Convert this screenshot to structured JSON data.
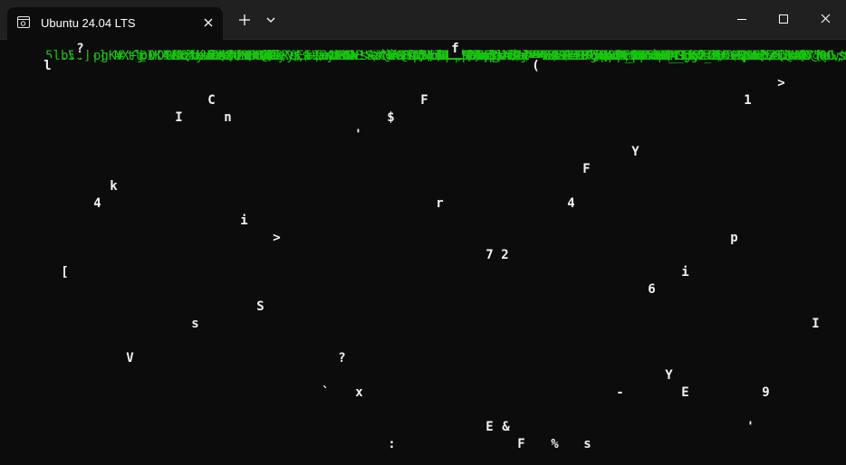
{
  "window": {
    "tab_title": "Ubuntu 24.04 LTS",
    "tab_icon": "terminal-tux-icon",
    "new_tab_icon": "plus-icon",
    "dropdown_icon": "chevron-down-icon",
    "controls": [
      "minimize-icon",
      "maximize-icon",
      "close-icon"
    ]
  },
  "terminal": {
    "text_color": "#16c60c",
    "highlight_color": "#f2f2f2",
    "background": "#0c0c0c",
    "columns": [
      "                  VD%N8c+UTXX",
      "                   %o\"y-h$[fV",
      "5l.50]-]'NX+j      b tm/ !L4CX",
      "bV                 o k /xk%%%",
      "?          !+h[               ",
      "pgK#.^@IK4                    ",
      "    o0'YIk                    ",
      "tl   8h\"XXVee8UmBB#V          ",
      "                     aa+vAb   ",
      "             Ak               ",
      "AzViIXh'zQ*.1?'s             ",
      "dxi\"eh t.@  .                  ",
      "lA\"C n l+y^$  iY       `  w.  .",
      "2d8DnNl+y^$   i             ",
      "                      q[<mM   ",
      "\\]mRcEIVSy00h!>:`wS    JSCf?'q[]",
      "l/Q,cIa1F0N!9  `  JSCf?'q[]   ",
      "   ,cNFSv AsNfN1VbtCf3'?Ru$<m`",
      "+\\:t'N s'X@A*fN  VtbM?u;?U!$<yU",
      "  sD    '                     ",
      "sHE'$Xsx@A  o   9bbqg?U!$<svs",
      "                o  #3ah8o5E$EP",
      "z^k-F7;)3qr   #3ah8oDNBBE>?7   ",
      "PS!67;)3qr                    ",
      "f             ejtY?0Sk2P?T\\    ",
      "NbS5L'dSt?vfZJ7PL<+L'R'oo2s   ",
      "SeQ5aBZ^v\\J7e7 :J  +;Rw51%.   ",
      "              E#CP5V5i7E:&    ",
      "              IV]=LrrVIrK&    ",
      "q(             ,<A_b#xWI4Tf/%",
      "            R,<A_b#xWI4T1/    ",
      "  zCz4TTBlqqd4               ",
      "  )  F:g bq qq                 ",
      "         ..2c`z#CLr2T-   /    ",
      "  \" D=EE0UTU2__ S2v6 \\\\S5?Z%2 ",
      "  5DS,YE:+7_SpSzd\\OO0*R'/     ",
      "       :cN9!RiO0             ",
      "   x H2    s1H HSUdx#D@^C    ",
      "                    cNR \\  : ",
      "6p)ITKf_Ars1pHHSUdx#D@^C    ",
      "      a  'pu[hS Ar6'9C fc  ",
      "ggl:!!:S 'I    A7\"> ,        ",
      "   <         [      #7?&r   ",
      ")T>          [u\\$NVfkgSy     ",
      "+^u>:![1m>'Npwsh$INvfkgsy    "
    ],
    "highlights": [
      {
        "text": "l"
      },
      {
        "text": "?"
      },
      {
        "text": "f"
      },
      {
        "text": "("
      },
      {
        "text": ">"
      },
      {
        "text": "1"
      },
      {
        "text": "C"
      },
      {
        "text": "F"
      },
      {
        "text": "I"
      },
      {
        "text": "n"
      },
      {
        "text": "$"
      },
      {
        "text": "'"
      },
      {
        "text": "k"
      },
      {
        "text": "Y"
      },
      {
        "text": "F"
      },
      {
        "text": "4"
      },
      {
        "text": "r"
      },
      {
        "text": "4"
      },
      {
        "text": "i"
      },
      {
        "text": ">"
      },
      {
        "text": "p"
      },
      {
        "text": "7"
      },
      {
        "text": "2"
      },
      {
        "text": "["
      },
      {
        "text": "i"
      },
      {
        "text": "S"
      },
      {
        "text": "6"
      },
      {
        "text": "s"
      },
      {
        "text": "I"
      },
      {
        "text": "V"
      },
      {
        "text": "?"
      },
      {
        "text": "Y"
      },
      {
        "text": "x"
      },
      {
        "text": "-"
      },
      {
        "text": "E"
      },
      {
        "text": "9"
      },
      {
        "text": "E"
      },
      {
        "text": "'"
      },
      {
        "text": "%"
      },
      {
        "text": "s"
      },
      {
        "text": "F"
      },
      {
        "text": "&"
      },
      {
        "text": "`"
      },
      {
        "text": ":"
      }
    ]
  }
}
